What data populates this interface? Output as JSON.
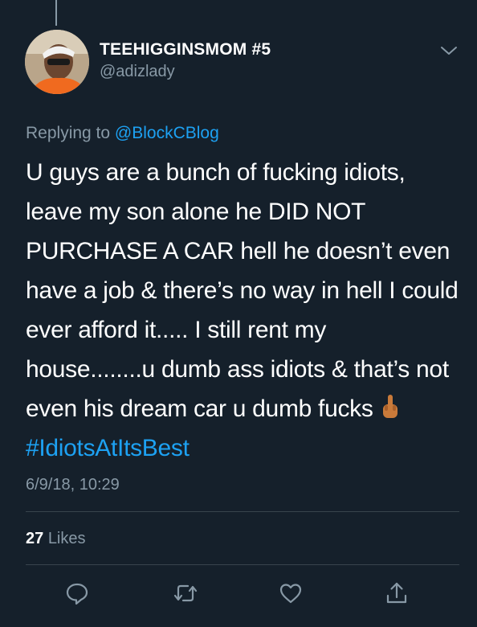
{
  "tweet": {
    "display_name": "TEEHIGGINSMOM #5",
    "handle": "@adizlady",
    "replying_prefix": "Replying to",
    "replying_to": "@BlockCBlog",
    "body_text": "U guys are a bunch of fucking idiots, leave my son alone he DID NOT PURCHASE A CAR hell he doesn’t even have a job & there’s no way in hell I could ever afford it..... I still rent my house........u dumb ass idiots & that’s not even his dream car u dumb fucks",
    "emoji": "middle-finger-emoji",
    "hashtag": "#IdiotsAtItsBest",
    "timestamp": "6/9/18, 10:29",
    "likes_count": "27",
    "likes_label": "Likes"
  },
  "actions": {
    "icons": [
      "reply-icon",
      "retweet-icon",
      "like-icon",
      "share-icon"
    ]
  },
  "colors": {
    "background": "#15202b",
    "text": "#ffffff",
    "secondary": "#8899a6",
    "link": "#1da1f2",
    "divider": "#38444d"
  }
}
